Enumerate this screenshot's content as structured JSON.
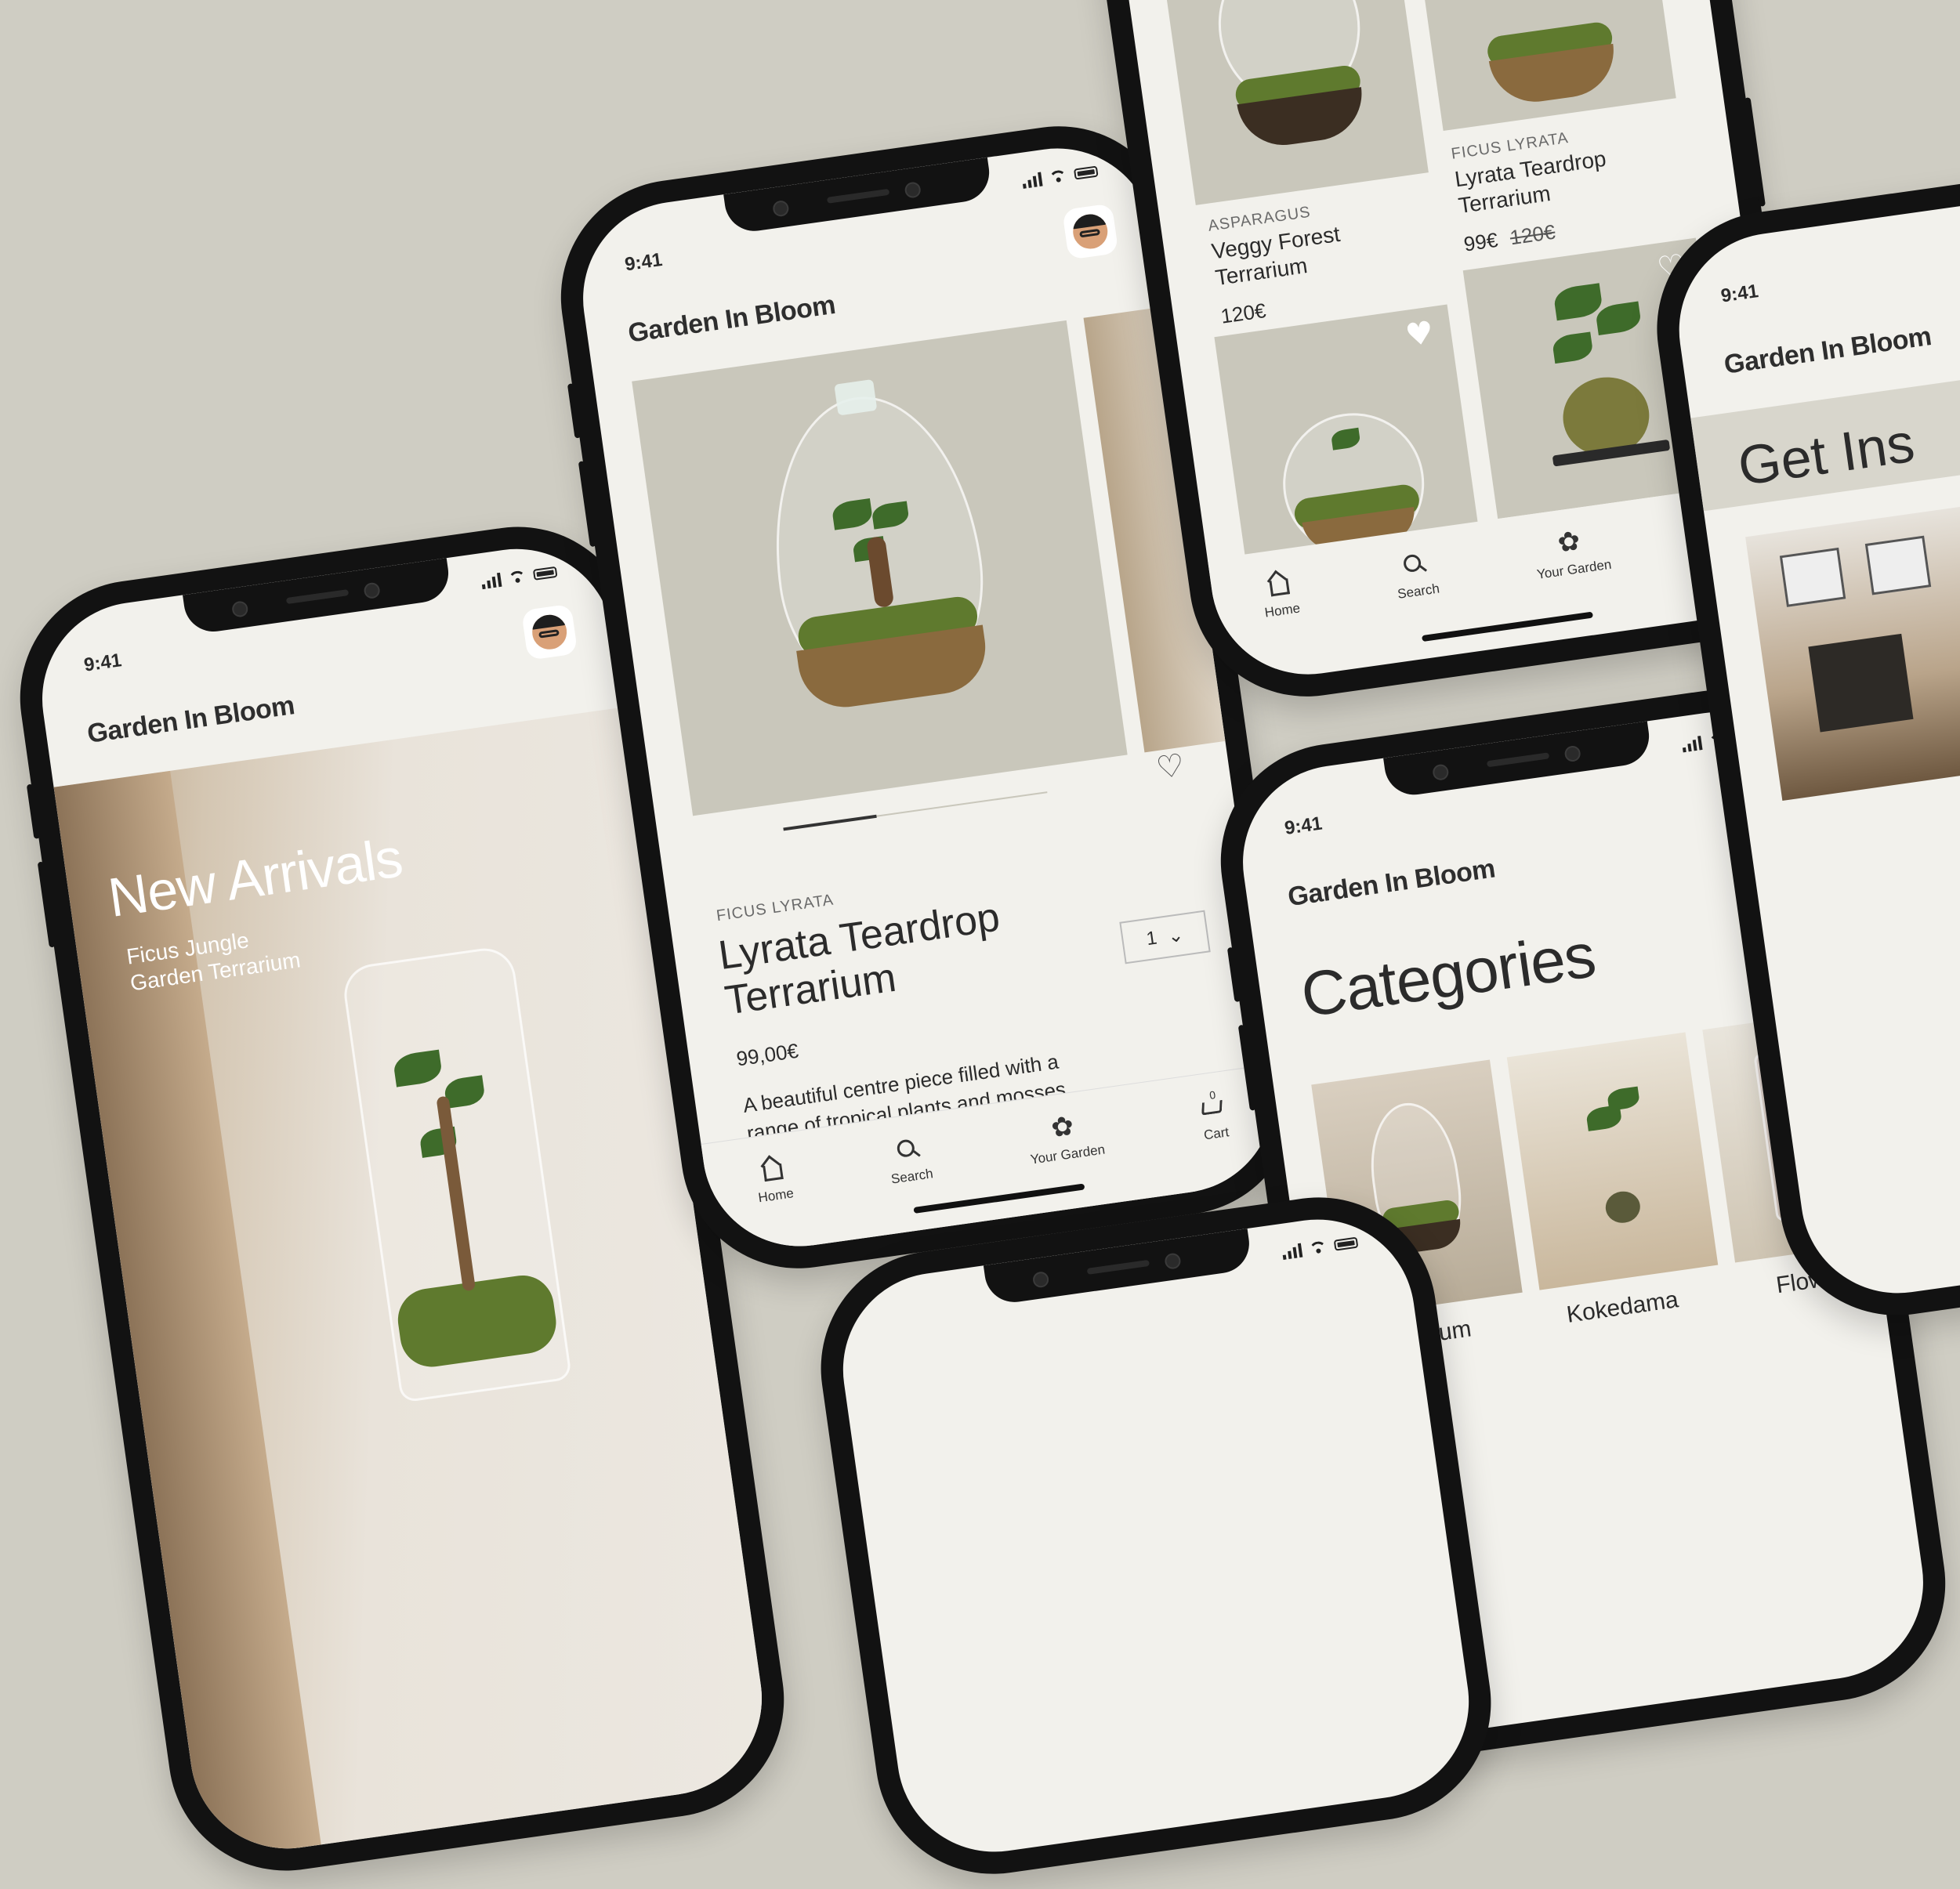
{
  "brand": "Garden In Bloom",
  "status_time": "9:41",
  "tabs": {
    "home": "Home",
    "search": "Search",
    "garden": "Your Garden",
    "cart": "Cart"
  },
  "hero": {
    "title": "New Arrivals",
    "subtitle_line1": "Ficus Jungle",
    "subtitle_line2": "Garden Terrarium"
  },
  "product": {
    "category": "FICUS LYRATA",
    "name_line1": "Lyrata Teardrop",
    "name_line2": "Terrarium",
    "price": "99,00€",
    "quantity": "1",
    "description_line1": "A beautiful centre piece filled with a",
    "description_line2": "range of tropical plants and mosses."
  },
  "grid": {
    "item1": {
      "category": "ASPARAGUS",
      "name_line1": "Veggy Forest",
      "name_line2": "Terrarium",
      "price": "120€"
    },
    "item2": {
      "category": "FICUS LYRATA",
      "name_line1": "Lyrata Teardrop",
      "name_line2": "Terrarium",
      "price": "99€",
      "old_price": "120€"
    }
  },
  "categories": {
    "title": "Categories",
    "items": [
      "Terrarium",
      "Kokedama",
      "Flowers"
    ]
  },
  "inspiration": {
    "title": "Get Ins"
  },
  "colors": {
    "background": "#cfcdc3",
    "screen": "#f2f1ec",
    "frame": "#121212",
    "image_bg": "#c9c7bb"
  }
}
